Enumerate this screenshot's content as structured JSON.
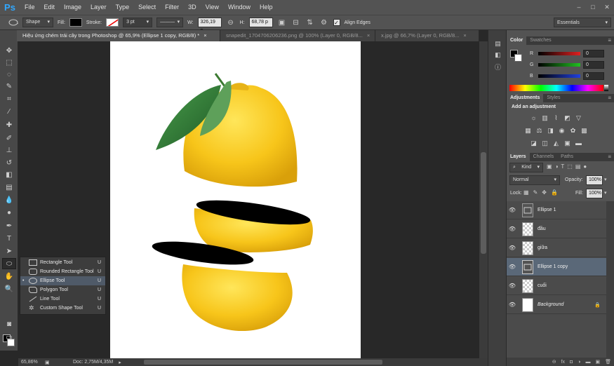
{
  "app": {
    "logo": "Ps"
  },
  "menu": [
    "File",
    "Edit",
    "Image",
    "Layer",
    "Type",
    "Select",
    "Filter",
    "3D",
    "View",
    "Window",
    "Help"
  ],
  "window_controls": [
    "–",
    "□",
    "✕"
  ],
  "options": {
    "tool_preset_icon": "ellipse-preset-icon",
    "mode": "Shape",
    "fill_label": "Fill:",
    "stroke_label": "Stroke:",
    "stroke_width": "3 pt",
    "w_label": "W:",
    "w_value": "326,19 p",
    "h_label": "H:",
    "h_value": "68,78 p",
    "align_edges": "Align Edges",
    "workspace": "Essentials"
  },
  "tabs": [
    {
      "title": "Hiệu ứng chém trái cây trong Photoshop @ 65,9% (Ellipse 1 copy, RGB/8) *",
      "close": "×"
    },
    {
      "title": "snapedit_1704706206236.png @ 100% (Layer 0, RGB/8...",
      "close": "×"
    },
    {
      "title": "x.jpg @ 66,7% (Layer 0, RGB/8...",
      "close": "×"
    }
  ],
  "flyout": [
    {
      "label": "Rectangle Tool",
      "key": "U"
    },
    {
      "label": "Rounded Rectangle Tool",
      "key": "U"
    },
    {
      "label": "Ellipse Tool",
      "key": "U"
    },
    {
      "label": "Polygon Tool",
      "key": "U"
    },
    {
      "label": "Line Tool",
      "key": "U"
    },
    {
      "label": "Custom Shape Tool",
      "key": "U"
    }
  ],
  "status": {
    "zoom": "65,86%",
    "doc": "Doc: 2,75M/4,35M"
  },
  "color_panel": {
    "tabs": [
      "Color",
      "Swatches"
    ],
    "channels": [
      {
        "label": "R",
        "value": "0"
      },
      {
        "label": "G",
        "value": "0"
      },
      {
        "label": "B",
        "value": "0"
      }
    ],
    "colors": {
      "r": "#e02020",
      "g": "#20c020",
      "b": "#2040e0"
    }
  },
  "adjustments_panel": {
    "tabs": [
      "Adjustments",
      "Styles"
    ],
    "heading": "Add an adjustment"
  },
  "layers_panel": {
    "tabs": [
      "Layers",
      "Channels",
      "Paths"
    ],
    "filter_kind": "Kind",
    "blend_mode": "Normal",
    "opacity_label": "Opacity:",
    "opacity": "100%",
    "lock_label": "Lock:",
    "fill_label": "Fill:",
    "fill": "100%",
    "layers": [
      {
        "name": "Ellipse 1",
        "type": "shape"
      },
      {
        "name": "đầu",
        "type": "raster"
      },
      {
        "name": "giữa",
        "type": "raster"
      },
      {
        "name": "Ellipse 1 copy",
        "type": "shape",
        "selected": true
      },
      {
        "name": "cuối",
        "type": "raster"
      },
      {
        "name": "Background",
        "type": "background"
      }
    ],
    "footer_icons": [
      "link-icon",
      "fx-icon",
      "mask-icon",
      "adjustment-icon",
      "group-icon",
      "new-layer-icon",
      "trash-icon"
    ]
  }
}
